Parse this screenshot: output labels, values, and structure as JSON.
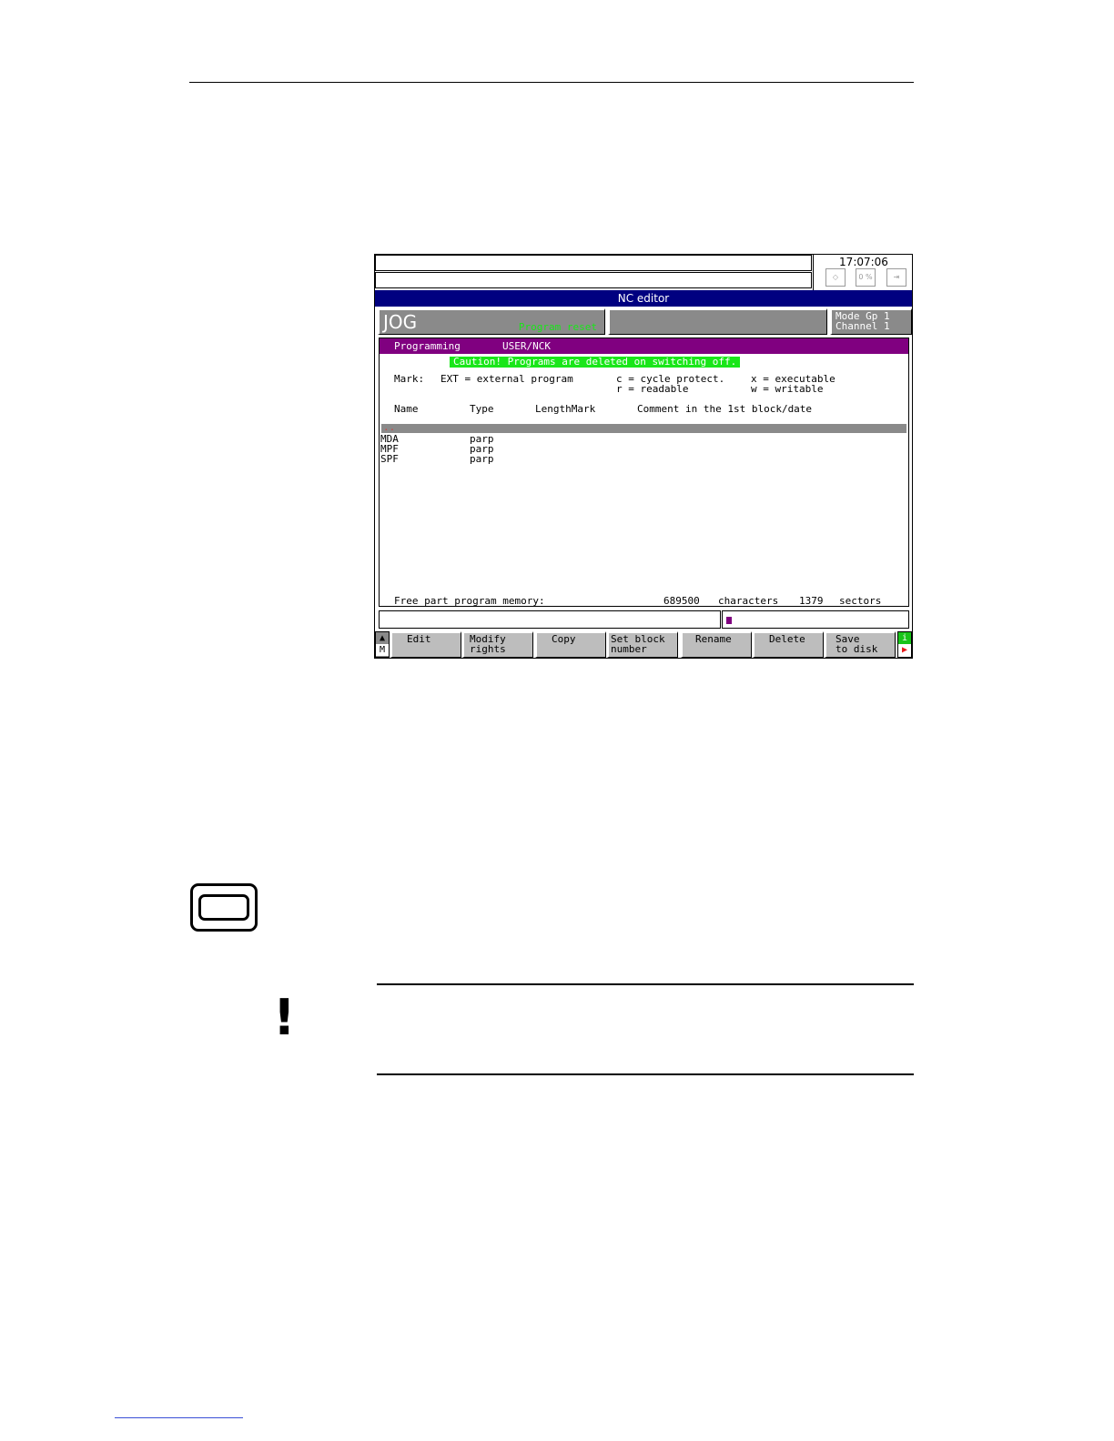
{
  "screen": {
    "clock": "17:07:06",
    "status_icons": [
      "feed-icon",
      "zero-percent-icon",
      "exit-icon"
    ],
    "zero_percent": "0 %",
    "title": "NC editor",
    "mode": "JOG",
    "program_state": "Program reset",
    "channel_line1": "Mode Gp 1",
    "channel_line2": "Channel 1",
    "area": {
      "name": "Programming",
      "path": "USER/NCK",
      "caution": "Caution! Programs are deleted on switching off.",
      "mark_label": "Mark:",
      "mark_ext": "EXT = external program",
      "mark_c": "c = cycle protect.",
      "mark_r": "r = readable",
      "mark_x": "x = executable",
      "mark_w": "w = writable",
      "columns": {
        "name": "Name",
        "type": "Type",
        "length_mark": "LengthMark",
        "comment": "Comment in the 1st block/date"
      },
      "parent_dir": "..",
      "rows": [
        {
          "name": "MDA",
          "type": "parp"
        },
        {
          "name": "MPF",
          "type": "parp"
        },
        {
          "name": "SPF",
          "type": "parp"
        }
      ],
      "memory_label": "Free part program memory:",
      "memory_chars": "689500",
      "chars_label": "characters",
      "memory_sectors": "1379",
      "sectors_label": "sectors"
    },
    "softkeys": {
      "left_up": "▲",
      "left_m": "M",
      "edit": "Edit",
      "modify_rights": "Modify\nrights",
      "copy": "Copy",
      "set_block_number": "Set block\nnumber",
      "rename": "Rename",
      "delete": "Delete",
      "save_to_disk": "Save\nto disk",
      "right_i": "i",
      "right_arrow": "▶"
    }
  },
  "colors": {
    "title_bar": "#000080",
    "area_header": "#800080",
    "caution_bg": "#19e619",
    "panel_grey": "#8a8a8a",
    "softkey_grey": "#bdbdbd"
  }
}
